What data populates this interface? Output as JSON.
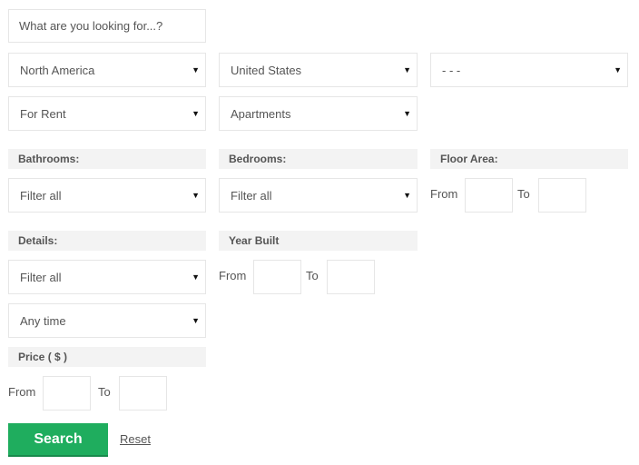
{
  "search": {
    "placeholder": "What are you looking for...?"
  },
  "selects": {
    "region": "North America",
    "country": "United States",
    "state": "- - -",
    "listing_type": "For Rent",
    "property_type": "Apartments",
    "bathrooms": "Filter all",
    "bedrooms": "Filter all",
    "details": "Filter all",
    "time": "Any time"
  },
  "labels": {
    "bathrooms": "Bathrooms:",
    "bedrooms": "Bedrooms:",
    "floor_area": "Floor Area:",
    "details": "Details:",
    "year_built": "Year Built",
    "price": "Price ( $ )",
    "from": "From",
    "to": "To"
  },
  "icons": {
    "dropdown": "▼"
  },
  "buttons": {
    "search": "Search",
    "reset": "Reset"
  },
  "colors": {
    "accent": "#1fad5e"
  }
}
